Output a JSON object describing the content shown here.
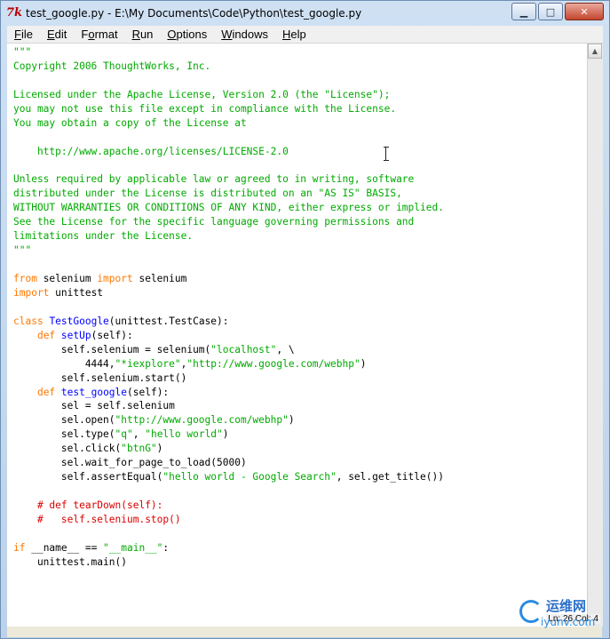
{
  "window": {
    "icon_glyph": "7k",
    "title": "test_google.py - E:\\My Documents\\Code\\Python\\test_google.py",
    "minimize_glyph": "▁",
    "maximize_glyph": "□",
    "close_glyph": "✕"
  },
  "menubar": {
    "items": [
      {
        "u": "F",
        "rest": "ile"
      },
      {
        "u": "E",
        "rest": "dit"
      },
      {
        "pre": "F",
        "u": "o",
        "rest": "rmat"
      },
      {
        "u": "R",
        "rest": "un"
      },
      {
        "u": "O",
        "rest": "ptions"
      },
      {
        "u": "W",
        "rest": "indows"
      },
      {
        "u": "H",
        "rest": "elp"
      }
    ]
  },
  "editor": {
    "lines": [
      [
        [
          "str",
          "\"\"\""
        ]
      ],
      [
        [
          "str",
          "Copyright 2006 ThoughtWorks, Inc."
        ]
      ],
      [
        [
          "str",
          ""
        ]
      ],
      [
        [
          "str",
          "Licensed under the Apache License, Version 2.0 (the \"License\");"
        ]
      ],
      [
        [
          "str",
          "you may not use this file except in compliance with the License."
        ]
      ],
      [
        [
          "str",
          "You may obtain a copy of the License at"
        ]
      ],
      [
        [
          "str",
          ""
        ]
      ],
      [
        [
          "str",
          "    http://www.apache.org/licenses/LICENSE-2.0"
        ]
      ],
      [
        [
          "str",
          ""
        ]
      ],
      [
        [
          "str",
          "Unless required by applicable law or agreed to in writing, software"
        ]
      ],
      [
        [
          "str",
          "distributed under the License is distributed on an \"AS IS\" BASIS,"
        ]
      ],
      [
        [
          "str",
          "WITHOUT WARRANTIES OR CONDITIONS OF ANY KIND, either express or implied."
        ]
      ],
      [
        [
          "str",
          "See the License for the specific language governing permissions and"
        ]
      ],
      [
        [
          "str",
          "limitations under the License."
        ]
      ],
      [
        [
          "str",
          "\"\"\""
        ]
      ],
      [
        [
          "txt",
          ""
        ]
      ],
      [
        [
          "kw",
          "from"
        ],
        [
          "txt",
          " selenium "
        ],
        [
          "kw",
          "import"
        ],
        [
          "txt",
          " selenium"
        ]
      ],
      [
        [
          "kw",
          "import"
        ],
        [
          "txt",
          " unittest"
        ]
      ],
      [
        [
          "txt",
          ""
        ]
      ],
      [
        [
          "kw",
          "class"
        ],
        [
          "txt",
          " "
        ],
        [
          "def",
          "TestGoogle"
        ],
        [
          "txt",
          "(unittest.TestCase):"
        ]
      ],
      [
        [
          "txt",
          "    "
        ],
        [
          "kw",
          "def"
        ],
        [
          "txt",
          " "
        ],
        [
          "def",
          "setUp"
        ],
        [
          "txt",
          "(self):"
        ]
      ],
      [
        [
          "txt",
          "        self.selenium = selenium("
        ],
        [
          "str",
          "\"localhost\""
        ],
        [
          "txt",
          ", \\"
        ]
      ],
      [
        [
          "txt",
          "            4444,"
        ],
        [
          "str",
          "\"*iexplore\""
        ],
        [
          "txt",
          ","
        ],
        [
          "str",
          "\"http://www.google.com/webhp\""
        ],
        [
          "txt",
          ")"
        ]
      ],
      [
        [
          "txt",
          "        self.selenium.start()"
        ]
      ],
      [
        [
          "txt",
          "    "
        ],
        [
          "kw",
          "def"
        ],
        [
          "txt",
          " "
        ],
        [
          "def",
          "test_google"
        ],
        [
          "txt",
          "(self):"
        ]
      ],
      [
        [
          "txt",
          "        sel = self.selenium"
        ]
      ],
      [
        [
          "txt",
          "        sel.open("
        ],
        [
          "str",
          "\"http://www.google.com/webhp\""
        ],
        [
          "txt",
          ")"
        ]
      ],
      [
        [
          "txt",
          "        sel.type("
        ],
        [
          "str",
          "\"q\""
        ],
        [
          "txt",
          ", "
        ],
        [
          "str",
          "\"hello world\""
        ],
        [
          "txt",
          ")"
        ]
      ],
      [
        [
          "txt",
          "        sel.click("
        ],
        [
          "str",
          "\"btnG\""
        ],
        [
          "txt",
          ")"
        ]
      ],
      [
        [
          "txt",
          "        sel.wait_for_page_to_load(5000)"
        ]
      ],
      [
        [
          "txt",
          "        self.assertEqual("
        ],
        [
          "str",
          "\"hello world - Google Search\""
        ],
        [
          "txt",
          ", sel.get_title())"
        ]
      ],
      [
        [
          "txt",
          ""
        ]
      ],
      [
        [
          "txt",
          "    "
        ],
        [
          "cmt",
          "# def tearDown(self):"
        ]
      ],
      [
        [
          "txt",
          "    "
        ],
        [
          "cmt",
          "#   self.selenium.stop()"
        ]
      ],
      [
        [
          "txt",
          ""
        ]
      ],
      [
        [
          "kw",
          "if"
        ],
        [
          "txt",
          " __name__ == "
        ],
        [
          "str",
          "\"__main__\""
        ],
        [
          "txt",
          ":"
        ]
      ],
      [
        [
          "txt",
          "    unittest.main()"
        ]
      ]
    ]
  },
  "statusbar": {
    "position": "Ln: 26 Col: 4"
  },
  "watermark": {
    "line1": "运维网",
    "line2": "iyunv.com"
  }
}
